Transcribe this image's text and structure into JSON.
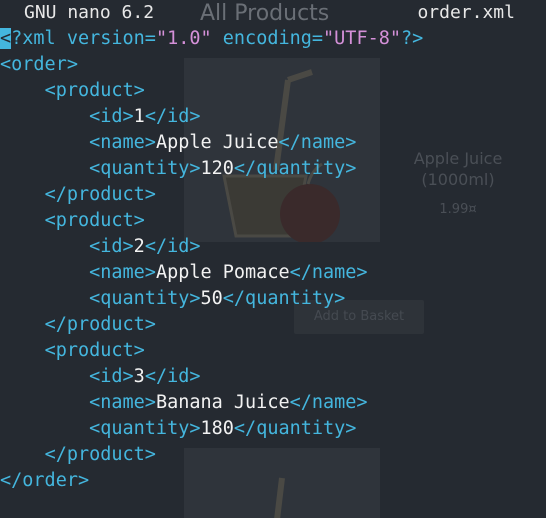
{
  "background_page": {
    "title": "All Products",
    "product_name": "Apple Juice (1000ml)",
    "product_price": "1.99¤",
    "add_button_label": "Add to Basket"
  },
  "titlebar": {
    "app": "GNU nano 6.2",
    "filename": "order.xml"
  },
  "editor": {
    "decl": {
      "open": "<",
      "pre": "?xml version=",
      "version": "\"1.0\"",
      "mid": " encoding=",
      "encoding": "\"UTF-8\"",
      "post": "?>"
    },
    "order_open": "<order>",
    "order_close": "</order>",
    "product_open": "<product>",
    "product_close": "</product>",
    "tags": {
      "id_open": "<id>",
      "id_close": "</id>",
      "name_open": "<name>",
      "name_close": "</name>",
      "qty_open": "<quantity>",
      "qty_close": "</quantity>"
    },
    "products": [
      {
        "id": "1",
        "name": "Apple Juice",
        "quantity": "120"
      },
      {
        "id": "2",
        "name": "Apple Pomace",
        "quantity": "50"
      },
      {
        "id": "3",
        "name": "Banana Juice",
        "quantity": "180"
      }
    ]
  },
  "colors": {
    "background": "#252a31",
    "tag": "#44b6de",
    "text": "#f2f2f2",
    "string": "#d490d8"
  }
}
